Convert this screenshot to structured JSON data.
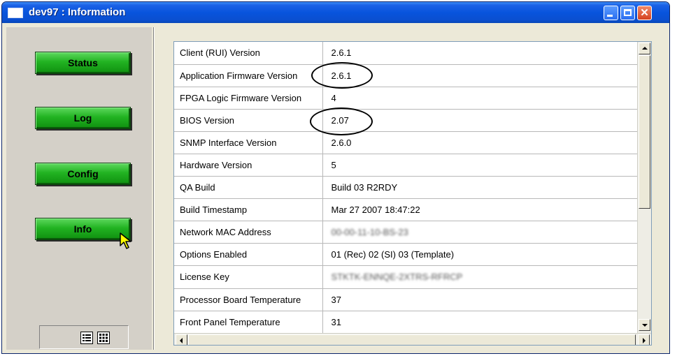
{
  "window": {
    "title": "dev97 : Information"
  },
  "nav": {
    "buttons": [
      {
        "label": "Status"
      },
      {
        "label": "Log"
      },
      {
        "label": "Config"
      },
      {
        "label": "Info"
      }
    ]
  },
  "info_table": {
    "rows": [
      {
        "key": "Client (RUI) Version",
        "value": "2.6.1"
      },
      {
        "key": "Application Firmware Version",
        "value": "2.6.1"
      },
      {
        "key": "FPGA Logic Firmware Version",
        "value": "4"
      },
      {
        "key": "BIOS Version",
        "value": "2.07"
      },
      {
        "key": "SNMP Interface Version",
        "value": "2.6.0"
      },
      {
        "key": "Hardware Version",
        "value": "5"
      },
      {
        "key": "QA Build",
        "value": "Build 03 R2RDY"
      },
      {
        "key": "Build Timestamp",
        "value": "Mar 27 2007 18:47:22"
      },
      {
        "key": "Network MAC Address",
        "value": "00-00-11-10-BS-23"
      },
      {
        "key": "Options Enabled",
        "value": "01 (Rec) 02 (SI) 03 (Template)"
      },
      {
        "key": "License Key",
        "value": "STKTK-ENNQE-2XTRS-RFRCP"
      },
      {
        "key": "Processor Board Temperature",
        "value": "37"
      },
      {
        "key": "Front Panel Temperature",
        "value": "31"
      }
    ]
  },
  "colors": {
    "titlebar": "#0854dd",
    "nav_button": "#22b322",
    "window_bg": "#ece9d8"
  },
  "icons": {
    "app": "window-icon",
    "list_view": "list-view-icon",
    "grid_view": "grid-view-icon",
    "cursor": "mouse-cursor-icon"
  }
}
